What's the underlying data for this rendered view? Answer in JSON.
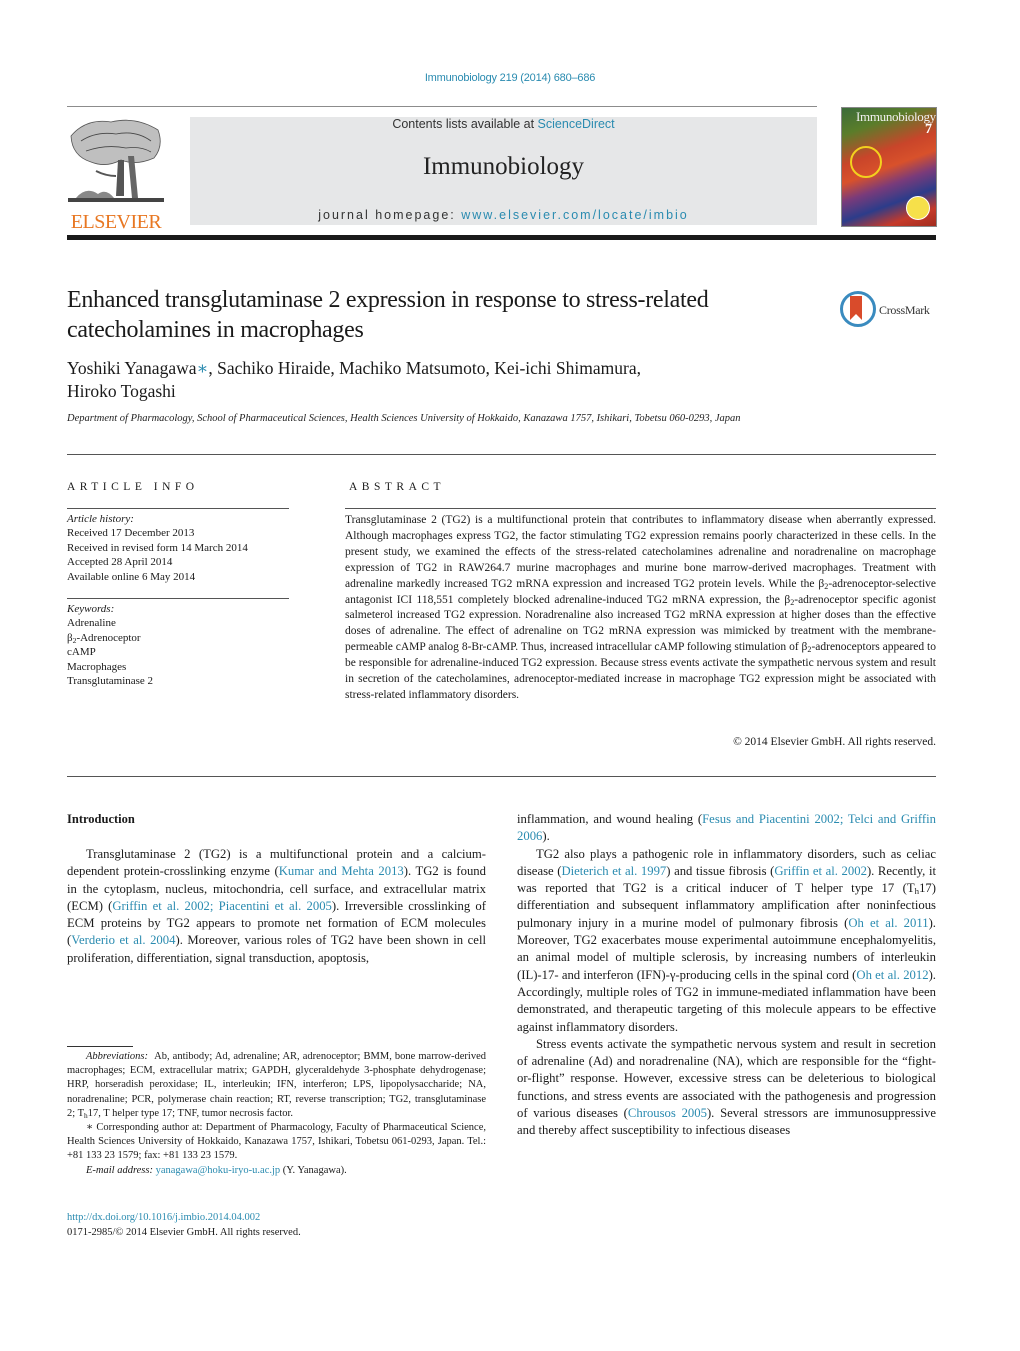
{
  "header": {
    "citation": "Immunobiology 219 (2014) 680–686",
    "contents_prefix": "Contents lists available at ",
    "contents_link": "ScienceDirect",
    "journal_name": "Immunobiology",
    "homepage_prefix": "journal homepage: ",
    "homepage_link": "www.elsevier.com/locate/imbio",
    "publisher_logo_text": "ELSEVIER",
    "cover_title": "Immunobiology",
    "cover_issue": "7"
  },
  "article": {
    "title": "Enhanced transglutaminase 2 expression in response to stress-related catecholamines in macrophages",
    "crossmark_label": "CrossMark",
    "authors": {
      "first": "Yoshiki Yanagawa",
      "first_mark": "∗",
      "rest": ", Sachiko Hiraide, Machiko Matsumoto, Kei-ichi Shimamura,",
      "line2": "Hiroko Togashi"
    },
    "affiliation": "Department of Pharmacology, School of Pharmaceutical Sciences, Health Sciences University of Hokkaido, Kanazawa 1757, Ishikari, Tobetsu 060-0293, Japan"
  },
  "article_info": {
    "heading": "ARTICLE INFO",
    "history_label": "Article history:",
    "history": [
      "Received 17 December 2013",
      "Received in revised form 14 March 2014",
      "Accepted 28 April 2014",
      "Available online 6 May 2014"
    ],
    "keywords_label": "Keywords:",
    "keywords": [
      "Adrenaline",
      "β2-Adrenoceptor",
      "cAMP",
      "Macrophages",
      "Transglutaminase 2"
    ]
  },
  "abstract": {
    "heading": "ABSTRACT",
    "text": "Transglutaminase 2 (TG2) is a multifunctional protein that contributes to inflammatory disease when aberrantly expressed. Although macrophages express TG2, the factor stimulating TG2 expression remains poorly characterized in these cells. In the present study, we examined the effects of the stress-related catecholamines adrenaline and noradrenaline on macrophage expression of TG2 in RAW264.7 murine macrophages and murine bone marrow-derived macrophages. Treatment with adrenaline markedly increased TG2 mRNA expression and increased TG2 protein levels. While the β2-adrenoceptor-selective antagonist ICI 118,551 completely blocked adrenaline-induced TG2 mRNA expression, the β2-adrenoceptor specific agonist salmeterol increased TG2 expression. Noradrenaline also increased TG2 mRNA expression at higher doses than the effective doses of adrenaline. The effect of adrenaline on TG2 mRNA expression was mimicked by treatment with the membrane-permeable cAMP analog 8-Br-cAMP. Thus, increased intracellular cAMP following stimulation of β2-adrenoceptors appeared to be responsible for adrenaline-induced TG2 expression. Because stress events activate the sympathetic nervous system and result in secretion of the catecholamines, adrenoceptor-mediated increase in macrophage TG2 expression might be associated with stress-related inflammatory disorders.",
    "copyright": "© 2014 Elsevier GmbH. All rights reserved."
  },
  "introduction": {
    "heading": "Introduction",
    "col1_p1": [
      {
        "t": "Transglutaminase 2 (TG2) is a multifunctional protein and a calcium-dependent protein-crosslinking enzyme ("
      },
      {
        "t": "Kumar and Mehta 2013",
        "link": true
      },
      {
        "t": "). TG2 is found in the cytoplasm, nucleus, mitochondria, cell surface, and extracellular matrix (ECM) ("
      },
      {
        "t": "Griffin et al. 2002; Piacentini et al. 2005",
        "link": true
      },
      {
        "t": "). Irreversible crosslinking of ECM proteins by TG2 appears to promote net formation of ECM molecules ("
      },
      {
        "t": "Verderio et al. 2004",
        "link": true
      },
      {
        "t": "). Moreover, various roles of TG2 have been shown in cell proliferation, differentiation, signal transduction, apoptosis,"
      }
    ],
    "col2_p0": [
      {
        "t": "inflammation, and wound healing ("
      },
      {
        "t": "Fesus and Piacentini 2002; Telci and Griffin 2006",
        "link": true
      },
      {
        "t": ")."
      }
    ],
    "col2_p1": [
      {
        "t": "TG2 also plays a pathogenic role in inflammatory disorders, such as celiac disease ("
      },
      {
        "t": "Dieterich et al. 1997",
        "link": true
      },
      {
        "t": ") and tissue fibrosis ("
      },
      {
        "t": "Griffin et al. 2002",
        "link": true
      },
      {
        "t": "). Recently, it was reported that TG2 is a critical inducer of T helper type 17 (Th17) differentiation and subsequent inflammatory amplification after noninfectious pulmonary injury in a murine model of pulmonary fibrosis ("
      },
      {
        "t": "Oh et al. 2011",
        "link": true
      },
      {
        "t": "). Moreover, TG2 exacerbates mouse experimental autoimmune encephalomyelitis, an animal model of multiple sclerosis, by increasing numbers of interleukin (IL)-17- and interferon (IFN)-γ-producing cells in the spinal cord ("
      },
      {
        "t": "Oh et al. 2012",
        "link": true
      },
      {
        "t": "). Accordingly, multiple roles of TG2 in immune-mediated inflammation have been demonstrated, and therapeutic targeting of this molecule appears to be effective against inflammatory disorders."
      }
    ],
    "col2_p2": [
      {
        "t": "Stress events activate the sympathetic nervous system and result in secretion of adrenaline (Ad) and noradrenaline (NA), which are responsible for the “fight-or-flight” response. However, excessive stress can be deleterious to biological functions, and stress events are associated with the pathogenesis and progression of various diseases ("
      },
      {
        "t": "Chrousos 2005",
        "link": true
      },
      {
        "t": "). Several stressors are immunosuppressive and thereby affect susceptibility to infectious diseases"
      }
    ]
  },
  "footnotes": {
    "abbrev_label": "Abbreviations:",
    "abbrev_text": "Ab, antibody; Ad, adrenaline; AR, adrenoceptor; BMM, bone marrow-derived macrophages; ECM, extracellular matrix; GAPDH, glyceraldehyde 3-phosphate dehydrogenase; HRP, horseradish peroxidase; IL, interleukin; IFN, interferon; LPS, lipopolysaccharide; NA, noradrenaline; PCR, polymerase chain reaction; RT, reverse transcription; TG2, transglutaminase 2; Th17, T helper type 17; TNF, tumor necrosis factor.",
    "corresponding": "∗ Corresponding author at: Department of Pharmacology, Faculty of Pharmaceutical Science, Health Sciences University of Hokkaido, Kanazawa 1757, Ishikari, Tobetsu 061-0293, Japan. Tel.: +81 133 23 1579; fax: +81 133 23 1579.",
    "email_label": "E-mail address:",
    "email": "yanagawa@hoku-iryo-u.ac.jp",
    "email_suffix": " (Y. Yanagawa)."
  },
  "doi": {
    "link": "http://dx.doi.org/10.1016/j.imbio.2014.04.002",
    "issn_line": "0171-2985/© 2014 Elsevier GmbH. All rights reserved."
  },
  "colors": {
    "link": "#2a8bb0",
    "elsevier_orange": "#e87722",
    "banner_gray": "#e6e7e8"
  }
}
